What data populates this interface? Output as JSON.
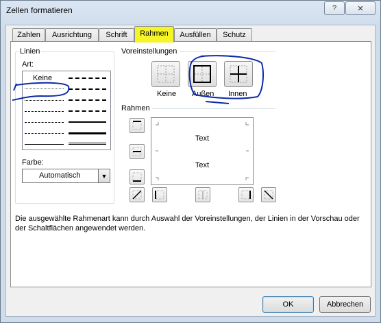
{
  "window": {
    "title": "Zellen formatieren"
  },
  "titlebar": {
    "help_label": "?",
    "close_label": "✕"
  },
  "tabs": [
    {
      "label": "Zahlen"
    },
    {
      "label": "Ausrichtung"
    },
    {
      "label": "Schrift"
    },
    {
      "label": "Rahmen"
    },
    {
      "label": "Ausfüllen"
    },
    {
      "label": "Schutz"
    }
  ],
  "active_tab": "Rahmen",
  "lines": {
    "group_label": "Linien",
    "style_label": "Art:",
    "none_label": "Keine",
    "color_label": "Farbe:",
    "color_value": "Automatisch"
  },
  "presets": {
    "group_label": "Voreinstellungen",
    "items": [
      {
        "label": "Keine"
      },
      {
        "label": "Außen"
      },
      {
        "label": "Innen"
      }
    ]
  },
  "border": {
    "group_label": "Rahmen",
    "preview_text_1": "Text",
    "preview_text_2": "Text"
  },
  "description": "Die ausgewählte Rahmenart kann durch Auswahl der Voreinstellungen, der Linien in der Vorschau oder der Schaltflächen angewendet werden.",
  "buttons": {
    "ok": "OK",
    "cancel": "Abbrechen"
  },
  "colors": {
    "highlight_tab": "#f4f428",
    "annotation_pen": "#0b2aa8"
  }
}
